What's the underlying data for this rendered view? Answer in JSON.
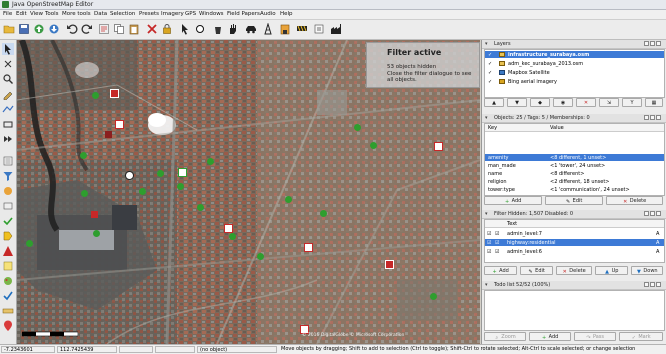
{
  "window": {
    "title": "Java OpenStreetMap Editor"
  },
  "menu": [
    "File",
    "Edit",
    "View",
    "Tools",
    "More tools",
    "Data",
    "Selection",
    "Presets",
    "Imagery",
    "GPS",
    "Windows",
    "Field Papers",
    "Audio",
    "Help"
  ],
  "toolbar_icons": [
    "open-icon",
    "save-icon",
    "upload-icon",
    "download-icon",
    "undo-icon",
    "redo-icon",
    "preferences-icon",
    "copy-icon",
    "paste-icon",
    "delete-icon",
    "lock-icon",
    "pointer-icon",
    "hand-icon",
    "car-icon",
    "tower-icon",
    "building-icon",
    "construction-icon",
    "industry-icon"
  ],
  "map": {
    "filter": {
      "title": "Filter active",
      "line1": "53 objects hidden",
      "line2": "Close the filter dialogue to see all objects."
    },
    "copyright": "© 2016 DigitalGlobe  © Microsoft Corporation"
  },
  "layers": {
    "header": "Layers",
    "items": [
      {
        "name": "infrastructure_surabaya.osm",
        "active": true
      },
      {
        "name": "adm_kec_surabaya_2013.osm",
        "active": false
      },
      {
        "name": "Mapbox Satellite",
        "active": false
      },
      {
        "name": "Bing aerial imagery",
        "active": false
      }
    ]
  },
  "tags": {
    "header": "Objects: 25 / Tags: 5 / Memberships: 0",
    "col_key": "Key",
    "col_value": "Value",
    "rows": [
      {
        "key": "amenity",
        "value": "<8 different, 1 unset>",
        "selected": true
      },
      {
        "key": "man_made",
        "value": "<1 'tower', 24 unset>",
        "selected": false
      },
      {
        "key": "name",
        "value": "<8 different>",
        "selected": false
      },
      {
        "key": "religion",
        "value": "<2 different, 18 unset>",
        "selected": false
      },
      {
        "key": "tower:type",
        "value": "<1 'communication', 24 unset>",
        "selected": false
      }
    ],
    "buttons": {
      "add": "Add",
      "edit": "Edit",
      "delete": "Delete"
    }
  },
  "filter": {
    "header": "Filter Hidden: 1,507 Disabled: 0",
    "col_text": "Text",
    "rows": [
      {
        "text": "admin_level:7",
        "flag": "A",
        "selected": false
      },
      {
        "text": "highway:residential",
        "flag": "A",
        "selected": true
      },
      {
        "text": "admin_level:6",
        "flag": "A",
        "selected": false
      }
    ],
    "buttons": {
      "add": "Add",
      "edit": "Edit",
      "delete": "Delete",
      "up": "Up",
      "down": "Down"
    }
  },
  "todo": {
    "header": "Todo list 52/52 (100%)",
    "buttons": {
      "zoom": "Zoom",
      "add": "Add",
      "pass": "Pass",
      "mark": "Mark"
    }
  },
  "status": {
    "lat": "-7.2343601",
    "lon": "112.7425439",
    "selection": "(no object)",
    "message": "Move objects by dragging; Shift to add to selection (Ctrl to toggle); Shift-Ctrl to rotate selected; Alt-Ctrl to scale selected; or change selection"
  },
  "colors": {
    "selection": "#3d7ad6",
    "marker_green": "#2e9e2e",
    "marker_red": "#c62828"
  }
}
